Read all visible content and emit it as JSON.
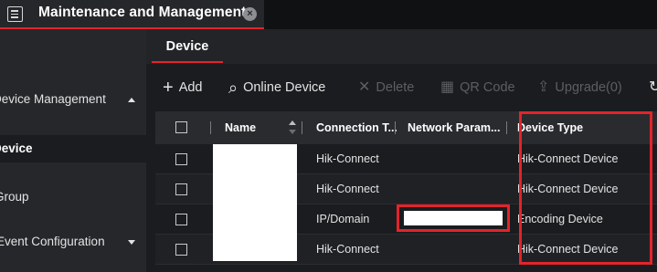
{
  "window": {
    "title": "Maintenance and Management",
    "close_glyph": "×"
  },
  "sidebar": {
    "items": [
      {
        "label": "Device Management",
        "expanded": true
      },
      {
        "label": "Device",
        "active": true
      },
      {
        "label": "Group"
      },
      {
        "label": "Event Configuration",
        "expanded": false
      }
    ]
  },
  "subtabs": [
    {
      "label": "Device",
      "active": true
    }
  ],
  "toolbar": {
    "add": {
      "icon": "plus-icon",
      "glyph": "+",
      "label": "Add"
    },
    "online": {
      "icon": "search-icon",
      "glyph": "⌕",
      "label": "Online Device"
    },
    "delete": {
      "icon": "close-icon",
      "glyph": "✕",
      "label": "Delete"
    },
    "qr": {
      "icon": "qr-code-icon",
      "glyph": "▦",
      "label": "QR Code"
    },
    "upgrade": {
      "icon": "upload-icon",
      "glyph": "⇪",
      "label": "Upgrade(0)"
    },
    "more": {
      "icon": "refresh-icon",
      "glyph": "↻"
    }
  },
  "table": {
    "columns": {
      "name": "Name",
      "connection": "Connection T...",
      "network": "Network Param...",
      "device_type": "Device Type"
    },
    "rows": [
      {
        "connection": "Hik-Connect",
        "network": "",
        "device_type": "Hik-Connect Device"
      },
      {
        "connection": "Hik-Connect",
        "network": "",
        "device_type": "Hik-Connect Device"
      },
      {
        "connection": "IP/Domain",
        "network": "",
        "device_type": "Encoding Device"
      },
      {
        "connection": "Hik-Connect",
        "network": "",
        "device_type": "Hik-Connect Device"
      }
    ]
  },
  "colors": {
    "accent": "#e3242b",
    "background": "#1b1c1f",
    "sidebar": "#26272b"
  }
}
